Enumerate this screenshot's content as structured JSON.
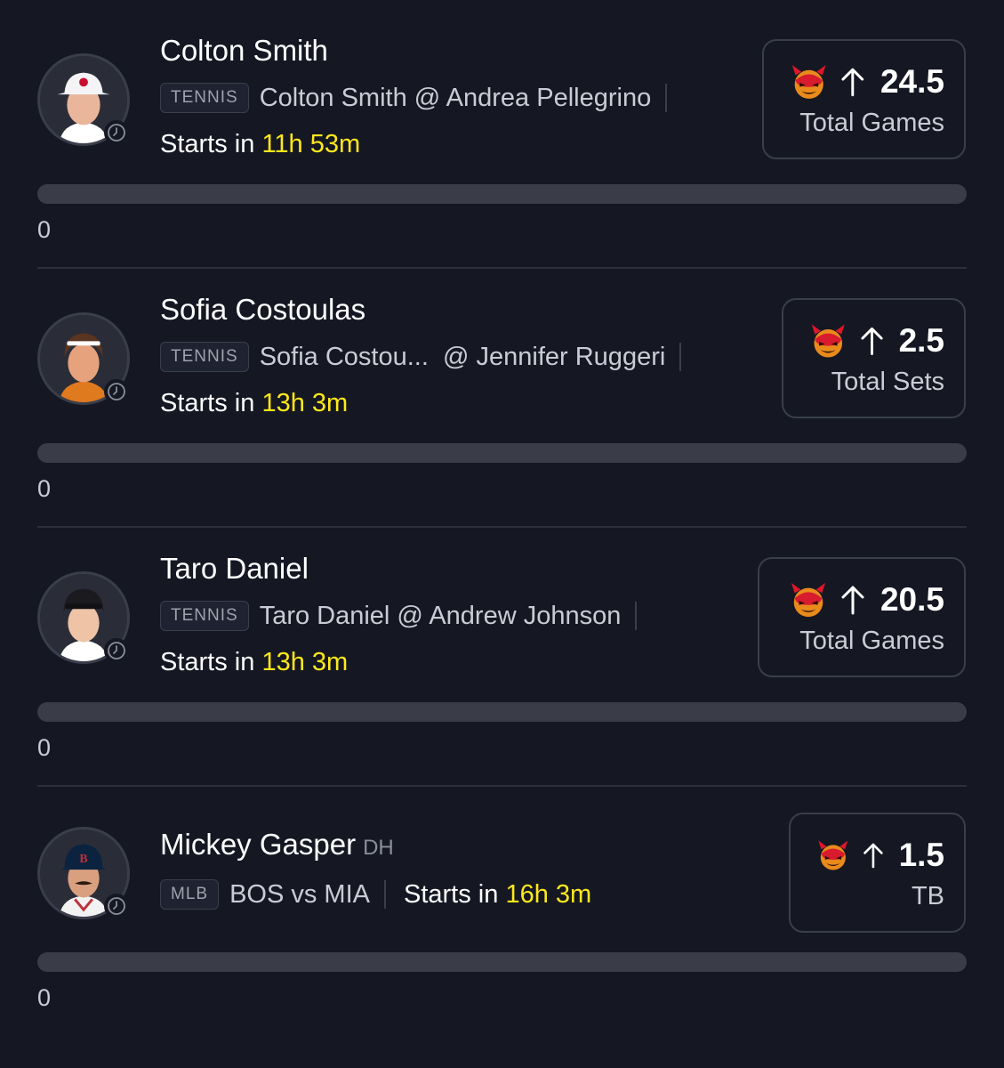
{
  "colors": {
    "background": "#151823",
    "highlight": "#ffe81a",
    "track": "#3a3c47"
  },
  "picks": [
    {
      "player_name": "Colton Smith",
      "position": "",
      "sport": "TENNIS",
      "matchup": "Colton Smith @ Andrea Pellegrino",
      "starts_prefix": "Starts in",
      "starts_time": "11h 53m",
      "line_value": "24.5",
      "stat_label": "Total Games",
      "direction_icon": "up-arrow-icon",
      "badge_icon": "demon-icon",
      "progress_value": 0,
      "progress_label": "0"
    },
    {
      "player_name": "Sofia Costoulas",
      "position": "",
      "sport": "TENNIS",
      "matchup": "Sofia Costou...  @ Jennifer Ruggeri",
      "starts_prefix": "Starts in",
      "starts_time": "13h 3m",
      "line_value": "2.5",
      "stat_label": "Total Sets",
      "direction_icon": "up-arrow-icon",
      "badge_icon": "demon-icon",
      "progress_value": 0,
      "progress_label": "0"
    },
    {
      "player_name": "Taro Daniel",
      "position": "",
      "sport": "TENNIS",
      "matchup": "Taro Daniel @ Andrew Johnson",
      "starts_prefix": "Starts in",
      "starts_time": "13h 3m",
      "line_value": "20.5",
      "stat_label": "Total Games",
      "direction_icon": "up-arrow-icon",
      "badge_icon": "demon-icon",
      "progress_value": 0,
      "progress_label": "0"
    },
    {
      "player_name": "Mickey Gasper",
      "position": "DH",
      "sport": "MLB",
      "matchup": "BOS vs MIA",
      "starts_prefix": "Starts in",
      "starts_time": "16h 3m",
      "line_value": "1.5",
      "stat_label": "TB",
      "direction_icon": "up-arrow-icon",
      "badge_icon": "demon-icon",
      "progress_value": 0,
      "progress_label": "0"
    }
  ]
}
